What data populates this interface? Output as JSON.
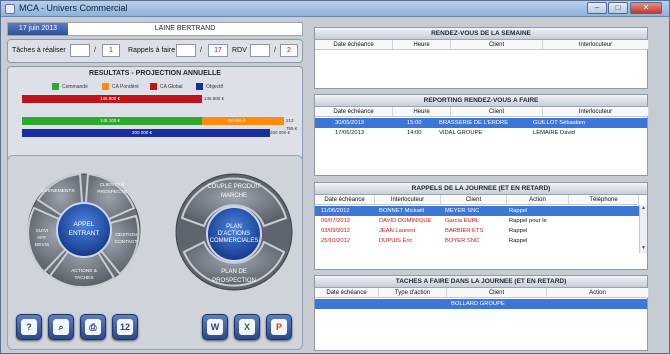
{
  "window": {
    "title": "MCA - Univers Commercial",
    "buttons": {
      "minimize": "–",
      "maximize": "□",
      "close": "✕"
    }
  },
  "header": {
    "date": "17 juin 2013",
    "user": "LAINE BERTRAND"
  },
  "counters": {
    "taches_label": "Tâches à réaliser",
    "taches_value": "",
    "taches_total": "1",
    "rappels_label": "Rappels à faire",
    "rappels_value": "",
    "rappels_total": "17",
    "rdv_label": "RDV",
    "rdv_value": "",
    "rdv_total": "2",
    "separator": "/"
  },
  "results": {
    "title": "RESULTATS - PROJECTION ANNUELLE",
    "legend": [
      {
        "label": "Commandé",
        "color": "#2ea82e"
      },
      {
        "label": "CA Pondéré",
        "color": "#ff8c10"
      },
      {
        "label": "CA Global",
        "color": "#c0141c"
      },
      {
        "label": "Objectif",
        "color": "#1a2ea0"
      }
    ],
    "bars": {
      "global_inner": "145 800 €",
      "global_outer": "145 800 €",
      "commande_inner": "145 100 €",
      "pondere_inner": "68 655 €",
      "pondere_outer": "213 755 €",
      "objectif_inner": "200 000 €",
      "objectif_outer": "200 000 €"
    }
  },
  "wheel_left": {
    "center": "APPEL\nENTRANT",
    "segments": [
      "EVENEMENTS",
      "CLIENTS & PROSPECTS",
      "GESTION CONTACT",
      "ACTIONS & TACHES",
      "SUIVI AFF. DEVIS"
    ]
  },
  "wheel_right": {
    "top": "COUPLE PRODUIT MARCHE",
    "center": "PLAN D'ACTIONS COMMERCIALES",
    "bottom": "PLAN DE PROSPECTION"
  },
  "bottom_icons_left": [
    "help-icon",
    "search-icon",
    "printer-icon",
    "calendar-icon"
  ],
  "calendar_day": "12",
  "bottom_icons_right": [
    "word-icon",
    "excel-icon",
    "powerpoint-icon"
  ],
  "rdv_semaine": {
    "title": "RENDEZ-VOUS DE LA SEMAINE",
    "columns": [
      "Date échéance",
      "Heure",
      "Client",
      "Interlocuteur"
    ],
    "rows": []
  },
  "reporting": {
    "title": "REPORTING RENDEZ-VOUS A FAIRE",
    "columns": [
      "Date échéance",
      "Heure",
      "Client",
      "Interlocuteur"
    ],
    "rows": [
      {
        "date": "30/05/2013",
        "heure": "15:00",
        "client": "BRASSERIE DE L'ERDRE",
        "interlocuteur": "GUILLOT Sébastien",
        "selected": true
      },
      {
        "date": "17/06/2013",
        "heure": "14:00",
        "client": "VIDAL GROUPE",
        "interlocuteur": "LEMAIRE David",
        "selected": false
      }
    ]
  },
  "rappels": {
    "title": "RAPPELS DE LA JOURNEE (ET EN RETARD)",
    "columns": [
      "Date échéance",
      "Interlocuteur",
      "Client",
      "Action",
      "Téléphone"
    ],
    "rows": [
      {
        "date": "11/06/2012",
        "interlocuteur": "BONNET Mickaël",
        "client": "MEYER SNC",
        "action": "Rappel",
        "telephone": "",
        "selected": true
      },
      {
        "date": "06/07/2012",
        "interlocuteur": "DAVID DOMINIQUE",
        "client": "Garcia EURL",
        "action": "Rappel pour le",
        "telephone": "",
        "selected": false
      },
      {
        "date": "03/09/2012",
        "interlocuteur": "JEAN Laurent",
        "client": "BARBIER ETS",
        "action": "Rappel",
        "telephone": "",
        "selected": false
      },
      {
        "date": "25/10/2012",
        "interlocuteur": "DUPUIS Eric",
        "client": "BOYER SNC",
        "action": "Rappel",
        "telephone": "",
        "selected": false
      }
    ]
  },
  "taches": {
    "title": "TACHES A FAIRE DANS LA JOURNEE (ET EN RETARD)",
    "columns": [
      "Date échéance",
      "Type d'action",
      "Client",
      "Action"
    ],
    "rows": [
      {
        "date": "",
        "type": "",
        "client": "BOLLARD GROUPE",
        "action": "",
        "selected": true
      }
    ]
  },
  "colors": {
    "accent": "#2e4f94",
    "selection": "#3d77d6",
    "late": "#d01818"
  }
}
